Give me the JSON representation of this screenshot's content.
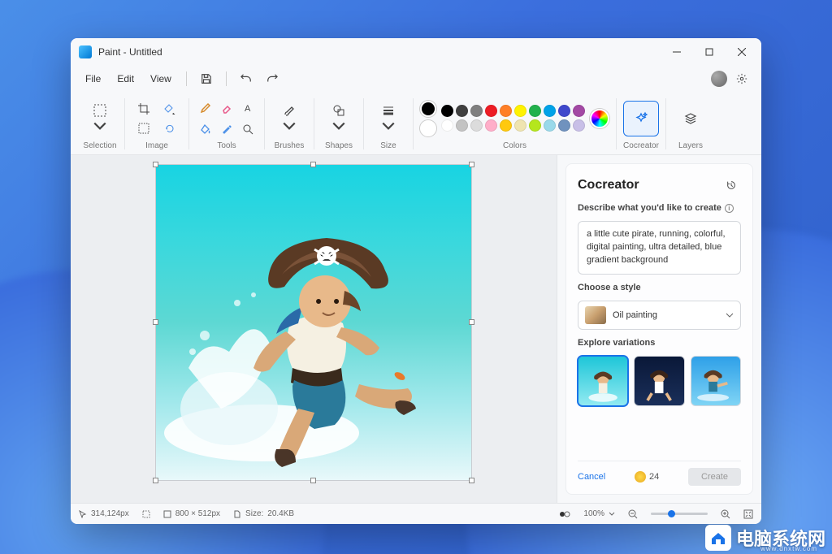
{
  "window": {
    "title": "Paint - Untitled"
  },
  "menubar": {
    "file": "File",
    "edit": "Edit",
    "view": "View"
  },
  "ribbon": {
    "selection": "Selection",
    "image": "Image",
    "tools": "Tools",
    "brushes": "Brushes",
    "shapes": "Shapes",
    "size": "Size",
    "colors": "Colors",
    "cocreator": "Cocreator",
    "layers": "Layers"
  },
  "palette_row1": [
    "#000000",
    "#404040",
    "#7f7f7f",
    "#ed1c24",
    "#ff7f27",
    "#fff200",
    "#22b14c",
    "#00a2e8",
    "#3f48cc",
    "#a349a4"
  ],
  "palette_row2": [
    "#ffffff",
    "#c3c3c3",
    "#dcdcdc",
    "#ffaec9",
    "#ffc90e",
    "#efe4b0",
    "#b5e61d",
    "#99d9ea",
    "#7092be",
    "#c8bfe7"
  ],
  "main_color": "#000000",
  "secondary_color": "#ffffff",
  "cocreator": {
    "title": "Cocreator",
    "describe_label": "Describe what you'd like to create",
    "prompt": "a little cute pirate, running, colorful, digital painting, ultra detailed, blue gradient background",
    "choose_style": "Choose a style",
    "style_name": "Oil painting",
    "explore": "Explore variations",
    "cancel": "Cancel",
    "create": "Create",
    "credits": "24"
  },
  "status": {
    "cursor": "314,124px",
    "dims": "800 × 512px",
    "size_label": "Size:",
    "size": "20.4KB",
    "zoom": "100%"
  },
  "watermark": {
    "text": "电脑系统网",
    "url": "www.dnxtw.com"
  }
}
